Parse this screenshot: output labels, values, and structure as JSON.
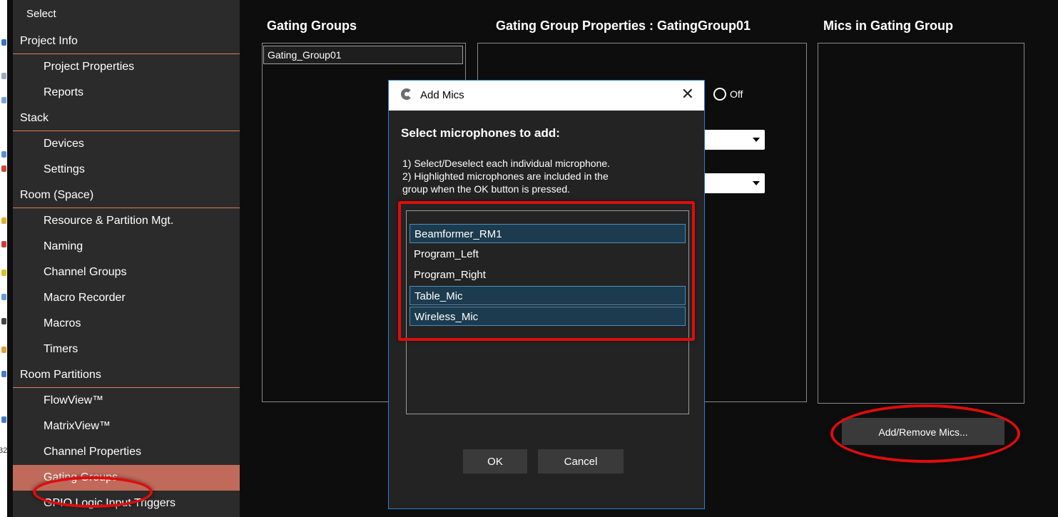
{
  "sidebar": {
    "top_item": "Select",
    "items": [
      {
        "label": "Project Info",
        "kind": "sec"
      },
      {
        "label": "Project Properties",
        "kind": "sub"
      },
      {
        "label": "Reports",
        "kind": "sub"
      },
      {
        "label": "Stack",
        "kind": "sec"
      },
      {
        "label": "Devices",
        "kind": "sub"
      },
      {
        "label": "Settings",
        "kind": "sub"
      },
      {
        "label": "Room (Space)",
        "kind": "sec"
      },
      {
        "label": "Resource & Partition Mgt.",
        "kind": "sub"
      },
      {
        "label": "Naming",
        "kind": "sub"
      },
      {
        "label": "Channel Groups",
        "kind": "sub"
      },
      {
        "label": "Macro Recorder",
        "kind": "sub"
      },
      {
        "label": "Macros",
        "kind": "sub"
      },
      {
        "label": "Timers",
        "kind": "sub"
      },
      {
        "label": "Room Partitions",
        "kind": "sec"
      },
      {
        "label": "FlowView™",
        "kind": "sub"
      },
      {
        "label": "MatrixView™",
        "kind": "sub"
      },
      {
        "label": "Channel Properties",
        "kind": "sub"
      },
      {
        "label": "Gating Groups",
        "kind": "sub",
        "active": true
      },
      {
        "label": "GPIO Logic Input Triggers",
        "kind": "sub"
      }
    ]
  },
  "sliver_number": "32",
  "gating_groups": {
    "header": "Gating Groups",
    "items": [
      "Gating_Group01"
    ]
  },
  "properties": {
    "header": "Gating Group Properties : GatingGroup01",
    "radio_off_label": "Off"
  },
  "mics_panel": {
    "header": "Mics in Gating Group",
    "add_remove_label": "Add/Remove Mics..."
  },
  "dialog": {
    "title": "Add Mics",
    "close_glyph": "✕",
    "heading": "Select microphones to add:",
    "instructions": [
      "1) Select/Deselect each individual microphone.",
      "2) Highlighted microphones are included in the",
      "group when the OK button is pressed."
    ],
    "mics": [
      {
        "name": "Beamformer_RM1",
        "selected": true
      },
      {
        "name": "Program_Left",
        "selected": false
      },
      {
        "name": "Program_Right",
        "selected": false
      },
      {
        "name": "Table_Mic",
        "selected": true
      },
      {
        "name": "Wireless_Mic",
        "selected": true
      }
    ],
    "ok_label": "OK",
    "cancel_label": "Cancel"
  },
  "colors": {
    "annotation_red": "#e00c0c",
    "active_item": "#bf6a5a",
    "section_rule": "#e07a5a",
    "selection_fill": "#1d3b4f",
    "dialog_border": "#2c7fd4"
  }
}
